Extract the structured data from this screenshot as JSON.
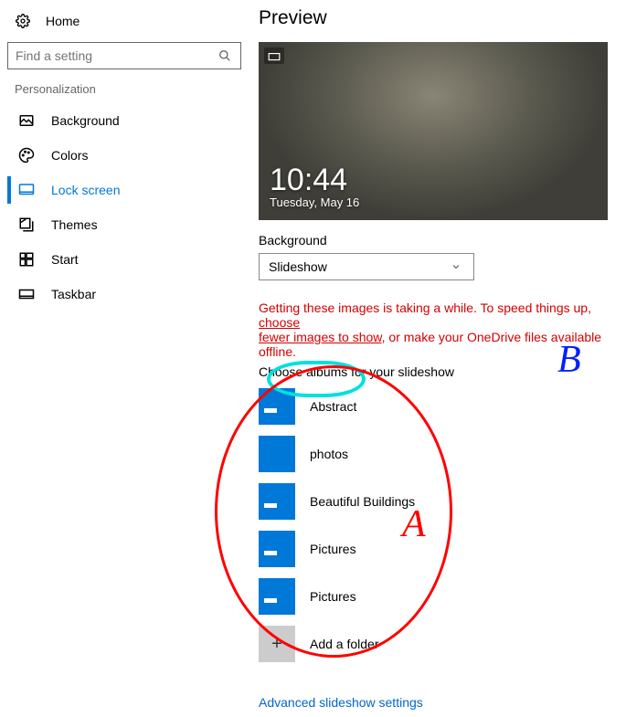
{
  "sidebar": {
    "home": "Home",
    "search_placeholder": "Find a setting",
    "section": "Personalization",
    "items": [
      {
        "label": "Background"
      },
      {
        "label": "Colors"
      },
      {
        "label": "Lock screen",
        "active": true
      },
      {
        "label": "Themes"
      },
      {
        "label": "Start"
      },
      {
        "label": "Taskbar"
      }
    ]
  },
  "main": {
    "preview_heading": "Preview",
    "clock": {
      "time": "10:44",
      "date": "Tuesday, May 16"
    },
    "bg_label": "Background",
    "bg_value": "Slideshow",
    "warning_pre": "Getting these images is taking a while. To speed things up, ",
    "warning_l1": "choose ",
    "warning_l2": "fewer images to show,",
    "warning_post": " or make your OneDrive files available offline.",
    "choose_header": "Choose albums for your slideshow",
    "albums": [
      {
        "label": "Abstract"
      },
      {
        "label": "photos"
      },
      {
        "label": "Beautiful Buildings"
      },
      {
        "label": "Pictures"
      },
      {
        "label": "Pictures"
      }
    ],
    "add_label": "Add a folder",
    "advanced_link": "Advanced slideshow settings"
  },
  "annotations": {
    "A": "A",
    "B": "B"
  }
}
